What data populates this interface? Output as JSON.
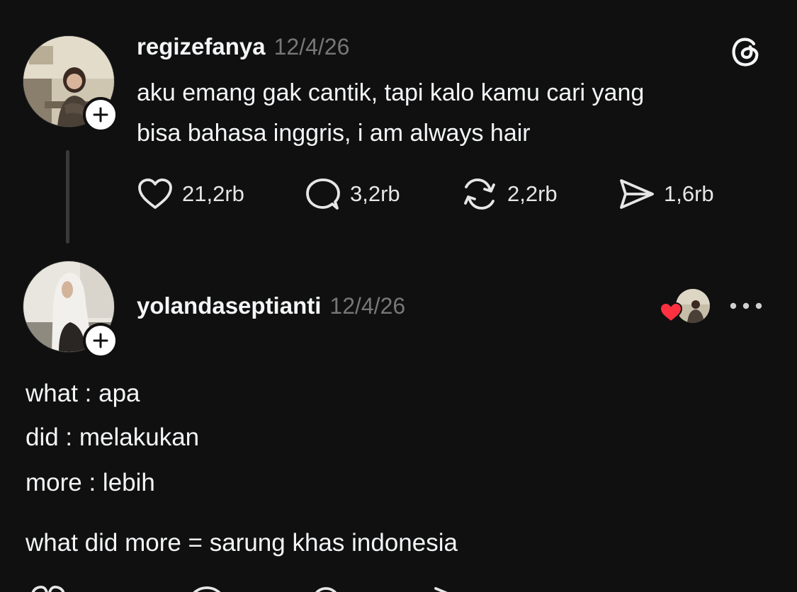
{
  "post": {
    "username": "regizefanya",
    "timestamp": "12/4/26",
    "text_line1": "aku emang gak cantik, tapi kalo kamu cari yang",
    "text_line2": "bisa bahasa inggris, i am always hair",
    "likes": "21,2rb",
    "comments": "3,2rb",
    "reposts": "2,2rb",
    "shares": "1,6rb"
  },
  "reply": {
    "username": "yolandaseptianti",
    "timestamp": "12/4/26",
    "lines": [
      "what : apa",
      "did : melakukan",
      "more : lebih",
      "what did more = sarung khas indonesia"
    ]
  },
  "icons": {
    "app_logo": "threads-logo-icon",
    "follow": "plus-icon",
    "like": "heart-icon",
    "comment": "comment-bubble-icon",
    "repost": "repost-icon",
    "share": "send-icon",
    "liked_by_author": "red-heart-icon",
    "more": "more-dots-icon"
  },
  "colors": {
    "background": "#101010",
    "text": "#f3f5f7",
    "muted": "#777777",
    "like_red": "#ff3040"
  }
}
